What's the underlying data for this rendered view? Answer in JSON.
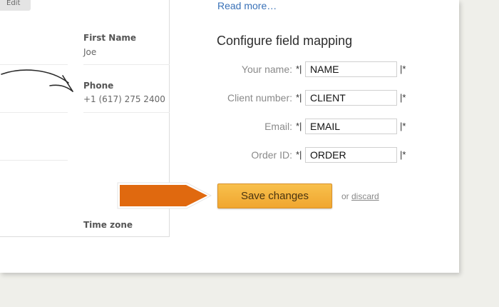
{
  "contact": {
    "edit_label": "Edit",
    "fields": [
      {
        "label": "First Name",
        "value": "Joe"
      },
      {
        "label": "Phone",
        "value": "+1 (617) 275 2400"
      },
      {
        "label": "Time zone"
      }
    ]
  },
  "config": {
    "read_more": "Read more…",
    "title": "Configure field mapping",
    "rows": [
      {
        "label": "Your name:",
        "prefix": "*|",
        "value": "NAME",
        "suffix": "|*"
      },
      {
        "label": "Client number:",
        "prefix": "*|",
        "value": "CLIENT",
        "suffix": "|*"
      },
      {
        "label": "Email:",
        "prefix": "*|",
        "value": "EMAIL",
        "suffix": "|*"
      },
      {
        "label": "Order ID:",
        "prefix": "*|",
        "value": "ORDER",
        "suffix": "|*"
      }
    ],
    "save_label": "Save changes",
    "or_text": "or",
    "discard_label": "discard"
  },
  "colors": {
    "page_bg": "#efefea",
    "link": "#3a72b8",
    "save_button": "#f4b03e",
    "callout_arrow": "#e0690f"
  },
  "icons": [
    "curved-arrow-icon",
    "callout-arrow-icon"
  ]
}
